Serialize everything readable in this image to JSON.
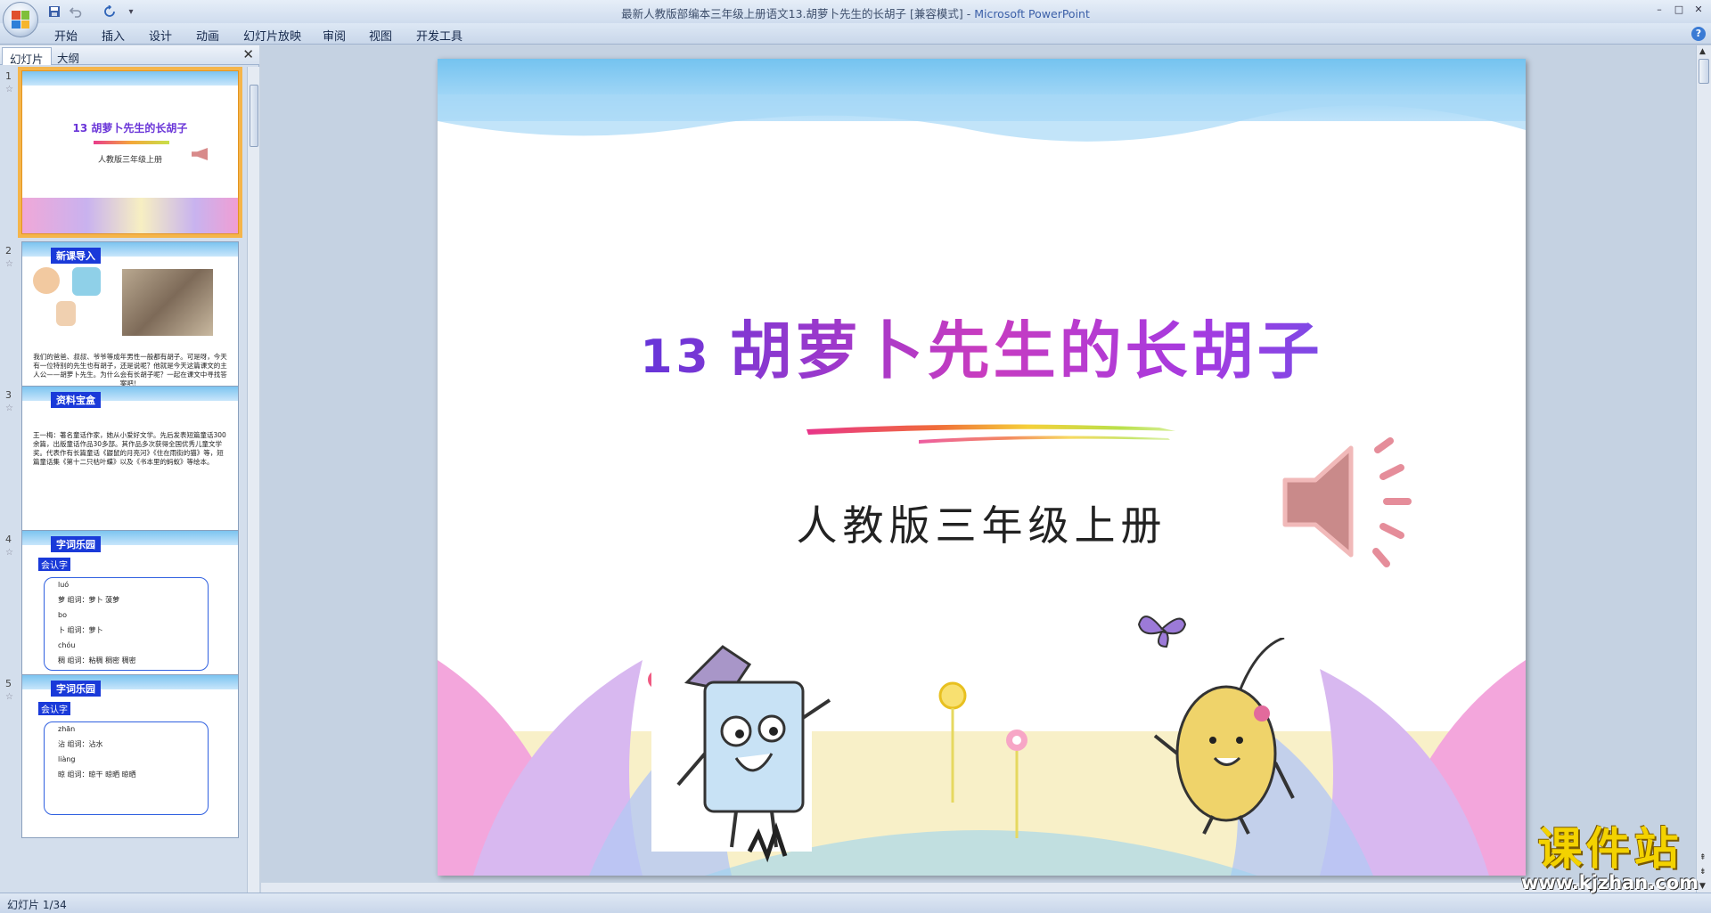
{
  "window": {
    "title": "最新人教版部编本三年级上册语文13.胡萝卜先生的长胡子 [兼容模式] - ",
    "app_name": "Microsoft PowerPoint",
    "minimize": "–",
    "maximize": "□",
    "close": "✕"
  },
  "quick_access": {
    "save_icon": "save-icon",
    "undo_icon": "undo-icon",
    "redo_icon": "redo-icon",
    "customize": "▾"
  },
  "menu": {
    "items": [
      "开始",
      "插入",
      "设计",
      "动画",
      "幻灯片放映",
      "审阅",
      "视图",
      "开发工具"
    ]
  },
  "help_label": "?",
  "pane": {
    "tab_slides": "幻灯片",
    "tab_outline": "大纲",
    "close": "✕"
  },
  "thumbnails": [
    {
      "number": "1",
      "title": "13 胡萝卜先生的长胡子",
      "subtitle": "人教版三年级上册"
    },
    {
      "number": "2",
      "banner": "新课导入",
      "text": "我们的爸爸、叔叔、爷爷等成年男性一般都有胡子。可是呀，今天有一位特别的先生也有胡子，还是说呢？他就是今天这篇课文的主人公——胡萝卜先生。为什么会有长胡子呢？一起在课文中寻找答案吧！"
    },
    {
      "number": "3",
      "banner": "资料宝盒",
      "text": "王一梅：著名童话作家，她从小爱好文学。先后发表短篇童话300余篇，出版童话作品30多部。其作品多次获得全国优秀儿童文学奖。代表作有长篇童话《鼹鼠的月亮河》《住在雨街的猫》等，短篇童话集《第十二只枯叶蝶》以及《书本里的蚂蚁》等绘本。"
    },
    {
      "number": "4",
      "banner": "字词乐园",
      "label": "会认字",
      "lines": [
        "luó",
        "萝   组词：萝卜  菠萝",
        "bo",
        "卜   组词：萝卜",
        "chóu",
        "稠   组词：粘稠  稠密  稠密"
      ]
    },
    {
      "number": "5",
      "banner": "字词乐园",
      "label": "会认字",
      "lines": [
        "zhān",
        "沾   组词：沾水",
        "liàng",
        "晾   组词：晾干  晾晒  晾晒"
      ]
    }
  ],
  "slide": {
    "number_label": "13",
    "title": "胡萝卜先生的长胡子",
    "subtitle": "人教版三年级上册",
    "speaker_icon": "speaker-icon"
  },
  "status": {
    "text": "幻灯片 1/34"
  },
  "watermark": {
    "main": "课件站",
    "url": "www.kjzhan.com"
  }
}
